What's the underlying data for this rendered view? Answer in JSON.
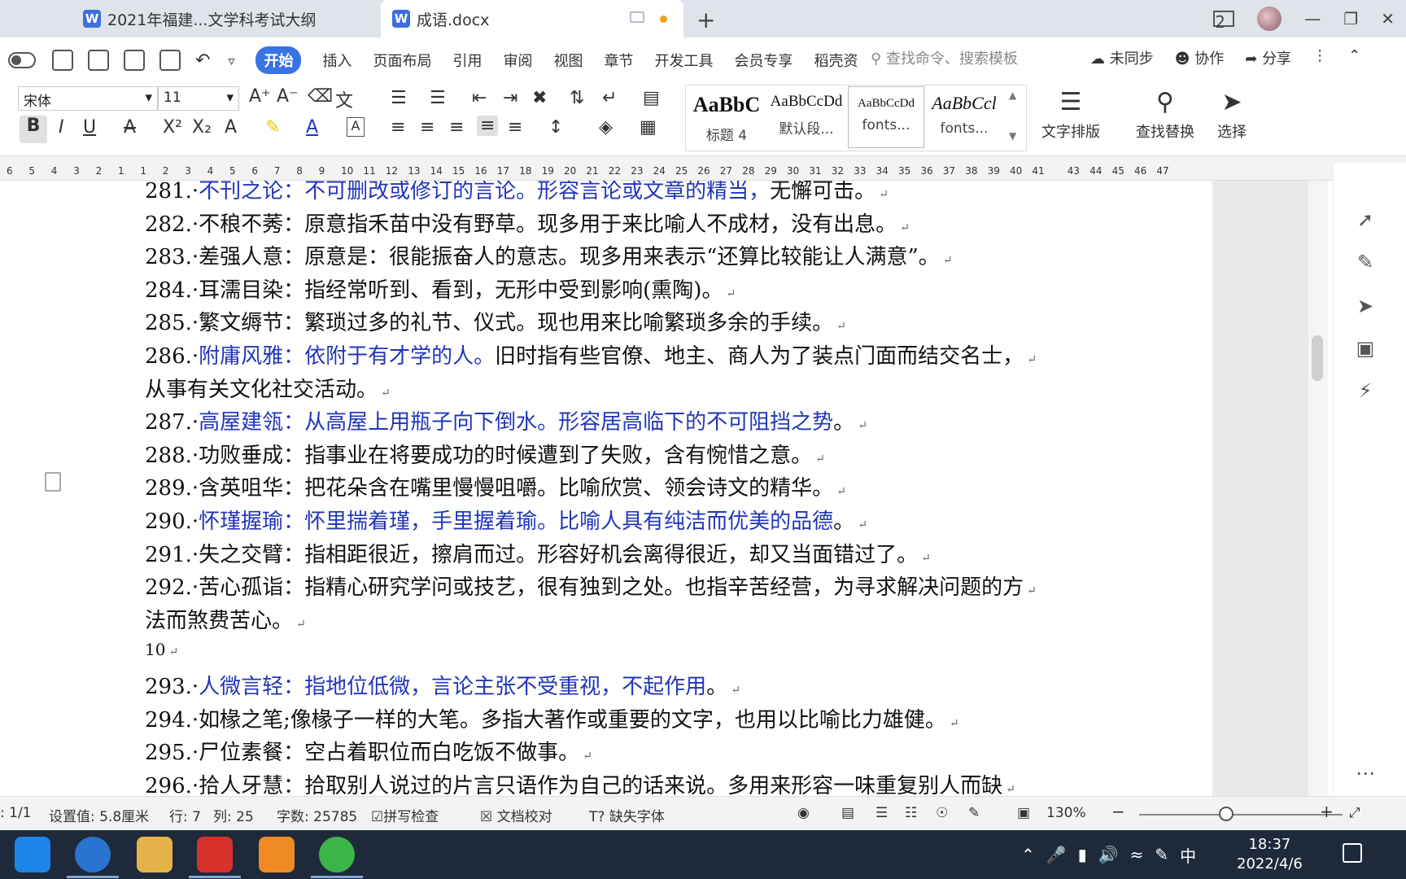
{
  "tabs": [
    {
      "label": "2021年福建...文学科考试大纲"
    },
    {
      "label": "成语.docx"
    }
  ],
  "new_tab_icon": "plus-icon",
  "menu": {
    "items": [
      "开始",
      "插入",
      "页面布局",
      "引用",
      "审阅",
      "视图",
      "章节",
      "开发工具",
      "会员专享",
      "稻壳资"
    ],
    "search_placeholder": "查找命令、搜索模板",
    "sync": "未同步",
    "collab": "协作",
    "share": "分享"
  },
  "ribbon": {
    "font_name": "宋体",
    "font_size": "11",
    "styles": [
      {
        "sample": "AaBbC",
        "name": "标题 4"
      },
      {
        "sample": "AaBbCcDd",
        "name": "默认段..."
      },
      {
        "sample": "AaBbCcDd",
        "name": "fonts..."
      },
      {
        "sample": "AaBbCcl",
        "name": "fonts..."
      }
    ],
    "layout_btn": "文字排版",
    "find_btn": "查找替换",
    "select_btn": "选择"
  },
  "ruler_ticks": [
    "6",
    "5",
    "4",
    "3",
    "2",
    "1",
    "1",
    "2",
    "3",
    "4",
    "5",
    "6",
    "7",
    "8",
    "9",
    "10",
    "11",
    "12",
    "13",
    "14",
    "15",
    "16",
    "17",
    "18",
    "19",
    "20",
    "21",
    "22",
    "23",
    "24",
    "25",
    "26",
    "27",
    "28",
    "29",
    "30",
    "31",
    "32",
    "33",
    "34",
    "35",
    "36",
    "37",
    "38",
    "39",
    "40",
    "41",
    "43",
    "44",
    "45",
    "46",
    "47"
  ],
  "document": {
    "lines": [
      {
        "num": "281.",
        "blue": "不刊之论：不可删改或修订的言论。形容言论或文章的精当，",
        "black": "无懈可击。"
      },
      {
        "num": "282.",
        "blue": "",
        "black": "不稂不莠：原意指禾苗中没有野草。现多用于来比喻人不成材，没有出息。"
      },
      {
        "num": "283.",
        "blue": "",
        "black": "差强人意：原意是：很能振奋人的意志。现多用来表示“还算比较能让人满意”。"
      },
      {
        "num": "284.",
        "blue": "",
        "black": "耳濡目染：指经常听到、看到，无形中受到影响(熏陶)。"
      },
      {
        "num": "285.",
        "blue": "",
        "black": "繁文缛节：繁琐过多的礼节、仪式。现也用来比喻繁琐多余的手续。"
      },
      {
        "num": "286.",
        "blue": "附庸风雅：依附于有才学的人。",
        "black": "旧时指有些官僚、地主、商人为了装点门面而结交名士，"
      },
      {
        "num": "",
        "blue": "",
        "black": "从事有关文化社交活动。"
      },
      {
        "num": "287.",
        "blue": "高屋建瓴：从高屋上用瓶子向下倒水。形容居高临下的不可阻挡之势",
        "black": "。"
      },
      {
        "num": "288.",
        "blue": "",
        "black": "功败垂成：指事业在将要成功的时候遭到了失败，含有惋惜之意。"
      },
      {
        "num": "289.",
        "blue": "",
        "black": "含英咀华：把花朵含在嘴里慢慢咀嚼。比喻欣赏、领会诗文的精华。"
      },
      {
        "num": "290.",
        "blue": "怀瑾握瑜：怀里揣着瑾，手里握着瑜。比喻人具有纯洁而优美的品德",
        "black": "。"
      },
      {
        "num": "291.",
        "blue": "",
        "black": "失之交臂：指相距很近，擦肩而过。形容好机会离得很近，却又当面错过了。"
      },
      {
        "num": "292.",
        "blue": "",
        "black": "苦心孤诣：指精心研究学问或技艺，很有独到之处。也指辛苦经营，为寻求解决问题的方"
      },
      {
        "num": "",
        "blue": "",
        "black": "法而煞费苦心。"
      },
      {
        "num": "",
        "blue": "",
        "black": "10"
      },
      {
        "num": "293.",
        "blue": "人微言轻：指地位低微，言论主张不受重视，不起作用",
        "black": "。"
      },
      {
        "num": "294.",
        "blue": "",
        "black": "如椽之笔;像椽子一样的大笔。多指大著作或重要的文字，也用以比喻比力雄健。"
      },
      {
        "num": "295.",
        "blue": "",
        "black": "尸位素餐：空占着职位而白吃饭不做事。"
      },
      {
        "num": "296.",
        "blue": "",
        "black": "拾人牙慧：拾取别人说过的片言只语作为自己的话来说。多用来形容一味重复别人而缺"
      }
    ]
  },
  "status": {
    "page": ": 1/1",
    "setting": "设置值: 5.8厘米",
    "row": "行: 7",
    "col": "列: 25",
    "wordcount": "字数: 25785",
    "spell": "拼写检查",
    "proof": "文档校对",
    "missing_font": "缺失字体",
    "zoom": "130%"
  },
  "clock": {
    "time": "18:37",
    "date": "2022/4/6"
  },
  "tray": {
    "ime": "中"
  }
}
